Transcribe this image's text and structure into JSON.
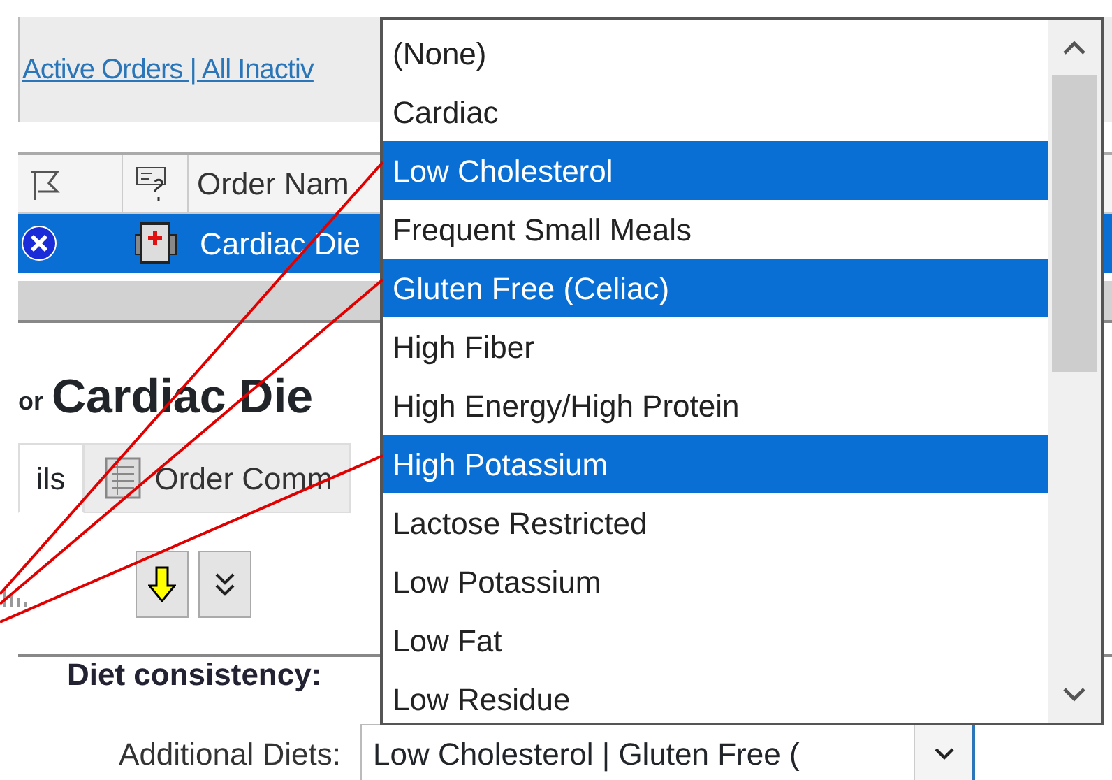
{
  "toolbar": {
    "link_text": "Active Orders | All Inactiv"
  },
  "grid": {
    "header_label": "Order Nam",
    "rows": [
      {
        "selected": true,
        "text": "Cardiac Die"
      }
    ]
  },
  "title": {
    "prefix": "or",
    "name": "Cardiac Die"
  },
  "tabs": [
    {
      "label": "ils",
      "selected": true
    },
    {
      "label": "Order Comm",
      "selected": false
    }
  ],
  "fields": [
    {
      "label": "Diet consistency:"
    },
    {
      "label": "Additional Diets:",
      "value": "Low Cholesterol | Gluten Free ("
    }
  ],
  "dropdown": {
    "items": [
      {
        "label": "(None)",
        "selected": false
      },
      {
        "label": "Cardiac",
        "selected": false
      },
      {
        "label": "Low Cholesterol",
        "selected": true
      },
      {
        "label": "Frequent Small Meals",
        "selected": false
      },
      {
        "label": "Gluten Free (Celiac)",
        "selected": true
      },
      {
        "label": "High Fiber",
        "selected": false
      },
      {
        "label": "High Energy/High Protein",
        "selected": false
      },
      {
        "label": "High Potassium",
        "selected": true
      },
      {
        "label": "Lactose Restricted",
        "selected": false
      },
      {
        "label": "Low Potassium",
        "selected": false
      },
      {
        "label": "Low Fat",
        "selected": false
      },
      {
        "label": "Low Residue",
        "selected": false
      }
    ]
  }
}
